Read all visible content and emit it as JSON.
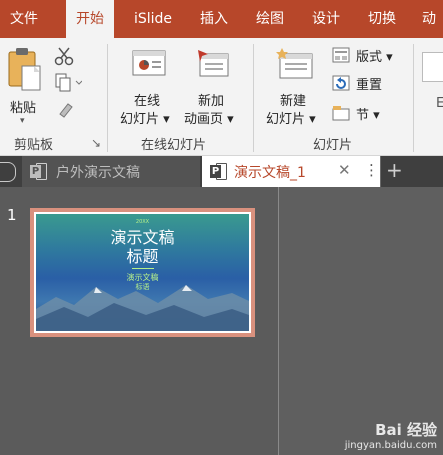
{
  "menu": {
    "tabs": [
      {
        "label": "文件"
      },
      {
        "label": "开始"
      },
      {
        "label": "iSlide"
      },
      {
        "label": "插入"
      },
      {
        "label": "绘图"
      },
      {
        "label": "设计"
      },
      {
        "label": "切换"
      },
      {
        "label": "动"
      }
    ],
    "active_index": 1
  },
  "ribbon": {
    "clipboard": {
      "paste_label": "粘贴",
      "paste_arrow": "▾",
      "group_label": "剪贴板",
      "launcher": "↘"
    },
    "online_slides": {
      "online_label_1": "在线",
      "online_label_2": "幻灯片 ▾",
      "new_anim_label_1": "新加",
      "new_anim_label_2": "动画页 ▾",
      "group_label": "在线幻灯片"
    },
    "slides": {
      "new_slide_label_1": "新建",
      "new_slide_label_2": "幻灯片 ▾",
      "layout_label": "版式 ▾",
      "reset_label": "重置",
      "section_label": "节 ▾",
      "group_label": "幻灯片",
      "cut_off_label": "E"
    }
  },
  "doc_tabs": [
    {
      "label": "户外演示文稿",
      "active": false
    },
    {
      "label": "演示文稿_1",
      "active": true
    }
  ],
  "doc_tab_controls": {
    "close": "✕",
    "more": "⋮",
    "add": "+"
  },
  "slide_panel": {
    "slide_number": "1",
    "thumbnail": {
      "year": "20XX",
      "title_line1": "演示文稿",
      "title_line2": "标题",
      "subtitle_line1": "演示文稿",
      "subtitle_line2": "标语"
    }
  },
  "watermark": {
    "brand": "Bai 经验",
    "url": "jingyan.baidu.com"
  },
  "colors": {
    "accent": "#b7472a",
    "ribbon_bg": "#f3f3f3",
    "workspace": "#5f5f5f"
  }
}
